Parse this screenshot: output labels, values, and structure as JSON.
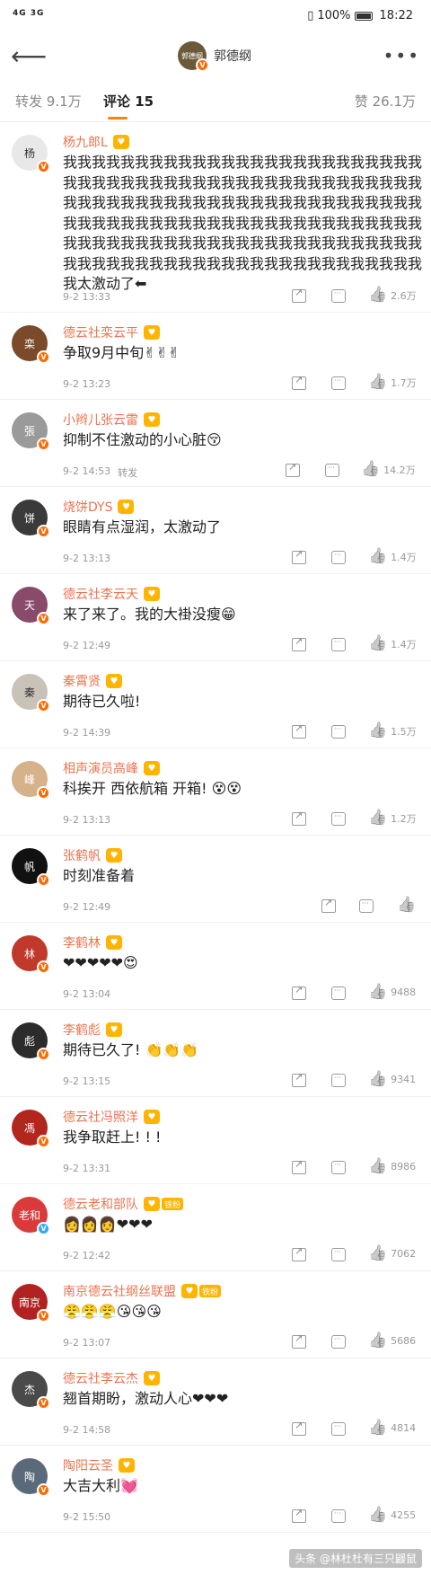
{
  "status_bar": {
    "signal": "4G  3G",
    "battery": "100%",
    "time": "18:22"
  },
  "nav": {
    "title": "郭德纲",
    "avatar_text": "郭德纲"
  },
  "tabs": {
    "repost": "转发 9.1万",
    "comment": "评论 15",
    "like": "赞 26.1万"
  },
  "comments": [
    {
      "name": "杨九郎L",
      "text": "我我我我我我我我我我我我我我我我我我我我我我我我我我我我我我我我我我我我我我我我我我我我我我我我我我我我我我我我我我我我我我我我我我我我我我我我我我我我我我我我我我我我我我我我我我我我我我我我我我我我我我我我我我我我我我我我我我我我我我我我我我我我我我我我我我我我我我我我我我我我我我我我我我我我我我我太激动了⬅",
      "time": "9-2 13:33",
      "likes": "2.6万",
      "avatar_text": "杨",
      "avatar_color": "#e8e8e8",
      "badge": "orange"
    },
    {
      "name": "德云社栾云平",
      "text": "争取9月中旬✌✌✌",
      "time": "9-2 13:23",
      "likes": "1.7万",
      "avatar_text": "栾",
      "avatar_color": "#7a4a2a",
      "badge": "orange"
    },
    {
      "name": "小辫儿张云雷",
      "text": "抑制不住激动的小心脏😚",
      "time": "9-2 14:53",
      "repost": "转发",
      "likes": "14.2万",
      "avatar_text": "張",
      "avatar_color": "#9a9a9a",
      "badge": "orange"
    },
    {
      "name": "烧饼DYS",
      "text": "眼睛有点湿润，太激动了",
      "time": "9-2 13:13",
      "likes": "1.4万",
      "avatar_text": "饼",
      "avatar_color": "#3a3a3a",
      "badge": "orange"
    },
    {
      "name": "德云社李云天",
      "text": "来了来了。我的大褂没瘦😁",
      "time": "9-2 12:49",
      "likes": "1.4万",
      "avatar_text": "天",
      "avatar_color": "#8a4a6a",
      "badge": "orange"
    },
    {
      "name": "秦霄贤",
      "text": "期待已久啦!",
      "time": "9-2 14:39",
      "likes": "1.5万",
      "avatar_text": "秦",
      "avatar_color": "#c9c2b8",
      "badge": "orange"
    },
    {
      "name": "相声演员高峰",
      "text": "科挨开 西依航箱 开箱!  😵😵",
      "time": "9-2 13:13",
      "likes": "1.2万",
      "avatar_text": "峰",
      "avatar_color": "#d6b28a",
      "badge": "orange"
    },
    {
      "name": "张鹤帆",
      "text": "时刻准备着",
      "time": "9-2 12:49",
      "likes": "",
      "avatar_text": "帆",
      "avatar_color": "#111111",
      "badge": "orange"
    },
    {
      "name": "李鹤林",
      "text": "❤❤❤❤❤😍",
      "time": "9-2 13:04",
      "likes": "9488",
      "avatar_text": "林",
      "avatar_color": "#c0392b",
      "badge": "orange"
    },
    {
      "name": "李鹤彪",
      "text": "期待已久了!  👏👏👏",
      "time": "9-2 13:15",
      "likes": "9341",
      "avatar_text": "彪",
      "avatar_color": "#2c2c2c",
      "badge": "orange"
    },
    {
      "name": "德云社冯照洋",
      "text": "我争取赶上!  !  !",
      "time": "9-2 13:31",
      "likes": "8986",
      "avatar_text": "馮",
      "avatar_color": "#b3261e",
      "badge": "orange"
    },
    {
      "name": "德云老和部队",
      "tag": "铁粉",
      "text": "👩👩👩❤❤❤",
      "time": "9-2 12:42",
      "likes": "7062",
      "avatar_text": "老和",
      "avatar_color": "#d93b3b",
      "badge": "blue"
    },
    {
      "name": "南京德云社纲丝联盟",
      "tag": "铁粉",
      "text": "😤😤😤😘😘😘",
      "time": "9-2 13:07",
      "likes": "5686",
      "avatar_text": "南京",
      "avatar_color": "#b22222",
      "badge": "orange"
    },
    {
      "name": "德云社李云杰",
      "text": "翘首期盼，激动人心❤❤❤",
      "time": "9-2 14:58",
      "likes": "4814",
      "avatar_text": "杰",
      "avatar_color": "#4a4a4a",
      "badge": "orange"
    },
    {
      "name": "陶阳云圣",
      "text": "大吉大利💓",
      "time": "9-2 15:50",
      "likes": "4255",
      "avatar_text": "陶",
      "avatar_color": "#5a6a7a",
      "badge": "orange"
    }
  ],
  "watermark": "头条 @林杜杜有三只鼹鼠"
}
